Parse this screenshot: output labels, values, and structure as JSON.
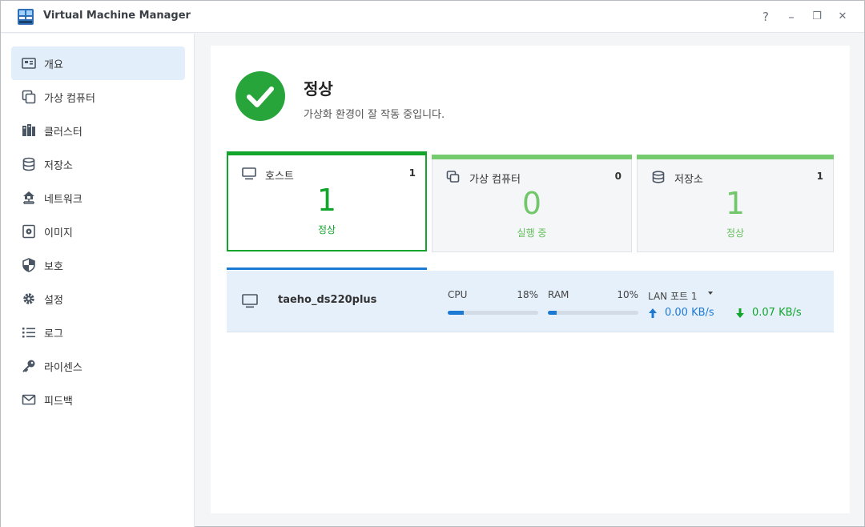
{
  "window": {
    "title": "Virtual Machine Manager",
    "controls": {
      "help": "?",
      "minimize": "–",
      "restore": "❐",
      "close": "✕"
    }
  },
  "sidebar": {
    "items": [
      {
        "label": "개요",
        "icon": "overview-icon",
        "active": true
      },
      {
        "label": "가상 컴퓨터",
        "icon": "virtual-machine-icon"
      },
      {
        "label": "클러스터",
        "icon": "cluster-icon"
      },
      {
        "label": "저장소",
        "icon": "storage-icon"
      },
      {
        "label": "네트워크",
        "icon": "network-icon"
      },
      {
        "label": "이미지",
        "icon": "image-icon"
      },
      {
        "label": "보호",
        "icon": "shield-icon"
      },
      {
        "label": "설정",
        "icon": "gear-icon"
      },
      {
        "label": "로그",
        "icon": "log-list-icon"
      },
      {
        "label": "라이센스",
        "icon": "key-icon"
      },
      {
        "label": "피드백",
        "icon": "mail-icon"
      }
    ]
  },
  "status": {
    "title": "정상",
    "description": "가상화 환경이 잘 작동 중입니다.",
    "color": "#27a53a"
  },
  "cards": [
    {
      "label": "호스트",
      "count": "1",
      "big": "1",
      "sub": "정상",
      "icon": "monitor-icon",
      "selected": true
    },
    {
      "label": "가상 컴퓨터",
      "count": "0",
      "big": "0",
      "sub": "실행 중",
      "icon": "virtual-machine-icon"
    },
    {
      "label": "저장소",
      "count": "1",
      "big": "1",
      "sub": "정상",
      "icon": "storage-icon"
    }
  ],
  "host": {
    "name": "taeho_ds220plus",
    "cpu_label": "CPU",
    "cpu_pct": "18%",
    "cpu_value": 0.18,
    "ram_label": "RAM",
    "ram_pct": "10%",
    "ram_value": 0.1,
    "lan_label": "LAN 포트 1",
    "upload": "0.00 KB/s",
    "download": "0.07 KB/s"
  },
  "colors": {
    "accent": "#1d7ad4",
    "success": "#11a52b",
    "success_light": "#74cc6e"
  }
}
